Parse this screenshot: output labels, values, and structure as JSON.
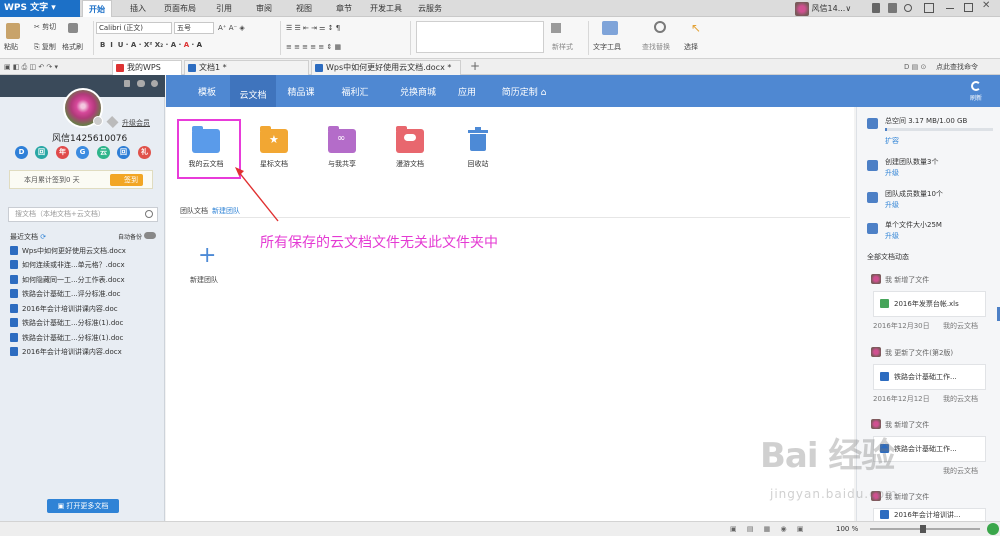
{
  "app": {
    "logo": "WPS 文字",
    "menu": [
      "开始",
      "插入",
      "页面布局",
      "引用",
      "审阅",
      "视图",
      "章节",
      "开发工具",
      "云服务"
    ],
    "user": "风信14...",
    "user_suffix": "∨"
  },
  "ribbon": {
    "paste": "粘贴",
    "cut": "剪切",
    "copy": "复制",
    "format_painter": "格式刷",
    "font_name": "Calibri (正文)",
    "font_size": "五号",
    "new_style": "新样式",
    "text_tools": "文字工具",
    "find_replace": "查找替换",
    "select": "选择",
    "help_link": "点此查找命令"
  },
  "tabs": [
    {
      "label": "我的WPS"
    },
    {
      "label": "文档1 *"
    },
    {
      "label": "Wps中如何更好使用云文档.docx *"
    }
  ],
  "left": {
    "username": "风信1425610076",
    "upgrade": "升级会员",
    "sign_info": "本月累计签到0 天",
    "sign_btn": "签到",
    "search_placeholder": "搜文档（本地文档+云文档）",
    "recent_title": "最近文档",
    "auto_backup": "自动备份",
    "open_more": "打开更多文档",
    "recent": [
      "Wps中如何更好使用云文档.docx",
      "如何连续或非连...单元格？.docx",
      "如何隐藏同一工...分工作表.docx",
      "铁路会计基础工...评分标准.doc",
      "2016年会计培训讲课内容.doc",
      "铁路会计基础工...分标准(1).doc",
      "铁路会计基础工...分标准(1).doc",
      "2016年会计培训讲课内容.docx"
    ],
    "app_icons": [
      "D",
      "回",
      "年",
      "G",
      "云",
      "回",
      "礼"
    ]
  },
  "nav": {
    "items": [
      "模板",
      "云文档",
      "精品课",
      "福利汇",
      "兑换商城",
      "应用",
      "简历定制"
    ],
    "refresh": "刷新"
  },
  "content": {
    "icons": [
      {
        "label": "我的云文档",
        "color": "#5a9bea"
      },
      {
        "label": "星标文档",
        "color": "#f2a733"
      },
      {
        "label": "与我共享",
        "color": "#b46cc9"
      },
      {
        "label": "漫游文档",
        "color": "#e8676e"
      },
      {
        "label": "回收站",
        "color": "#4d8ad6"
      }
    ],
    "team_label": "团队文档",
    "new_team_link": "新建团队",
    "new_team": "新建团队",
    "annotation": "所有保存的云文档文件无关此文件夹中"
  },
  "right": {
    "space": "总空间 3.17 MB/1.00 GB",
    "expand": "扩容",
    "team_count": "创建团队数量3个",
    "member_count": "团队成员数量10个",
    "file_size": "单个文件大小25M",
    "upgrade": "升级",
    "activity": "全部文档动态",
    "feed": [
      {
        "action": "我 新增了文件",
        "file": "2016年发票台帐.xls",
        "date": "2016年12月30日",
        "where": "我的云文档",
        "color": "#46a55a"
      },
      {
        "action": "我 更新了文件(第2版)",
        "file": "铁路会计基础工作...",
        "date": "2016年12月12日",
        "where": "我的云文档",
        "color": "#2d6cc0"
      },
      {
        "action": "我 新增了文件",
        "file": "铁路会计基础工作...",
        "date": "",
        "where": "我的云文档",
        "color": "#2d6cc0"
      },
      {
        "action": "我 新增了文件",
        "file": "2016年会计培训讲...",
        "date": "",
        "where": "",
        "color": "#2d6cc0"
      }
    ]
  },
  "status": {
    "zoom": "100 %"
  },
  "watermark": {
    "main": "Bai 经验",
    "sub": "jingyan.baidu.com"
  }
}
